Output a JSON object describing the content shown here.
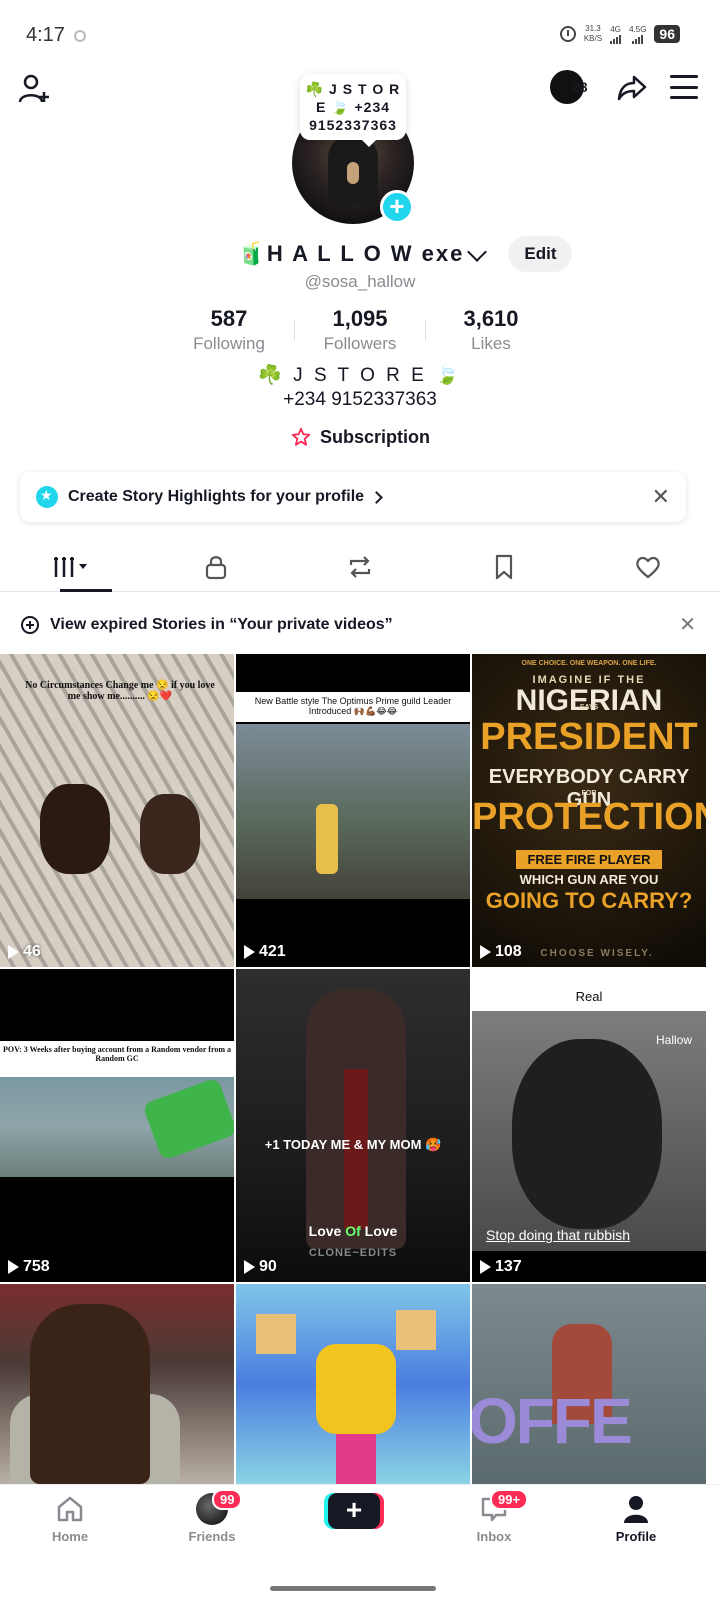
{
  "status_bar": {
    "time": "4:17",
    "net_speed_top": "31.3",
    "net_speed_bottom": "KB/S",
    "signal1": "4G",
    "signal2": "4.5G",
    "battery": "96"
  },
  "header": {
    "mini_avatar_count": "28",
    "note_bubble": "☘️ J S T O R E 🍃 +234 9152337363"
  },
  "profile": {
    "display_name": "🧃H A L L O W exe",
    "edit_label": "Edit",
    "username": "@sosa_hallow",
    "stats": [
      {
        "value": "587",
        "label": "Following"
      },
      {
        "value": "1,095",
        "label": "Followers"
      },
      {
        "value": "3,610",
        "label": "Likes"
      }
    ],
    "bio_line1": "☘️ J S T O R E 🍃",
    "bio_line2": "+234 9152337363",
    "subscription_label": "Subscription"
  },
  "highlights_banner": {
    "text": "Create Story Highlights for your profile"
  },
  "tabs": [
    {
      "icon": "grid-videos-icon"
    },
    {
      "icon": "lock-icon"
    },
    {
      "icon": "repost-icon"
    },
    {
      "icon": "bookmark-icon"
    },
    {
      "icon": "heart-icon"
    }
  ],
  "expired_stories": {
    "text": "View expired Stories in “Your private videos”"
  },
  "videos": [
    {
      "views": "46",
      "caption": "No Circumstances Change me 😒 if you love me show me.......... 😒❤️"
    },
    {
      "views": "421",
      "caption": "New Battle style The Optimus Prime guild Leader Introduced 🙌🏾💪🏾😂😂"
    },
    {
      "views": "108",
      "lines": [
        "ONE CHOICE. ONE WEAPON. ONE LIFE.",
        "IMAGINE IF THE",
        "NIGERIAN",
        "PRESIDENT",
        "SAYS",
        "EVERYBODY CARRY GUN",
        "FOR",
        "PROTECTION",
        "FREE FIRE PLAYER",
        "WHICH GUN ARE YOU",
        "GOING TO CARRY?",
        "CHOOSE WISELY."
      ]
    },
    {
      "views": "758",
      "caption": "POV: 3 Weeks after buying account from a Random vendor from a Random GC"
    },
    {
      "views": "90",
      "caption": "+1 TODAY ME & MY MOM 🥵",
      "love_text": "Love",
      "of_text": "Of",
      "love_text2": "Love",
      "credit": "CLONE~EDITS"
    },
    {
      "views": "137",
      "label": "Real",
      "watermark": "Hallow",
      "bottom_caption": "Stop doing that rubbish"
    },
    {
      "views": ""
    },
    {
      "views": ""
    },
    {
      "views": "",
      "big_text": "OFFE"
    }
  ],
  "bottom_nav": {
    "home": "Home",
    "friends": "Friends",
    "friends_badge": "99",
    "inbox": "Inbox",
    "inbox_badge": "99+",
    "profile": "Profile"
  }
}
